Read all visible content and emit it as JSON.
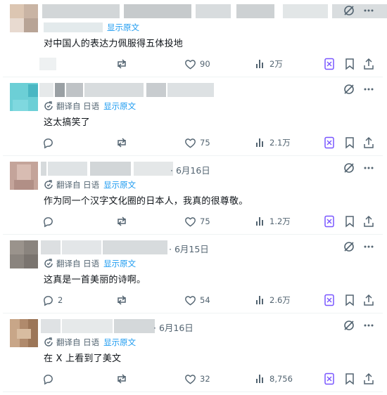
{
  "show_original": "显示原文",
  "translate_label": "翻译自 日语",
  "tweets": [
    {
      "date": "",
      "text": "对中国人的表达力佩服得五体投地",
      "reply_count": "",
      "like_count": "90",
      "view_count": "2万"
    },
    {
      "date": "",
      "text": "这太搞笑了",
      "reply_count": "",
      "like_count": "75",
      "view_count": "2.1万"
    },
    {
      "date": "· 6月16日",
      "text": "作为同一个汉字文化圈的日本人，我真的很尊敬。",
      "reply_count": "",
      "like_count": "75",
      "view_count": "1.2万"
    },
    {
      "date": "· 6月15日",
      "text": "这真是一首美丽的诗啊。",
      "reply_count": "2",
      "like_count": "54",
      "view_count": "2.6万"
    },
    {
      "date": "· 6月16日",
      "text": "在 X 上看到了美文",
      "reply_count": "",
      "like_count": "32",
      "view_count": "8,756"
    }
  ]
}
